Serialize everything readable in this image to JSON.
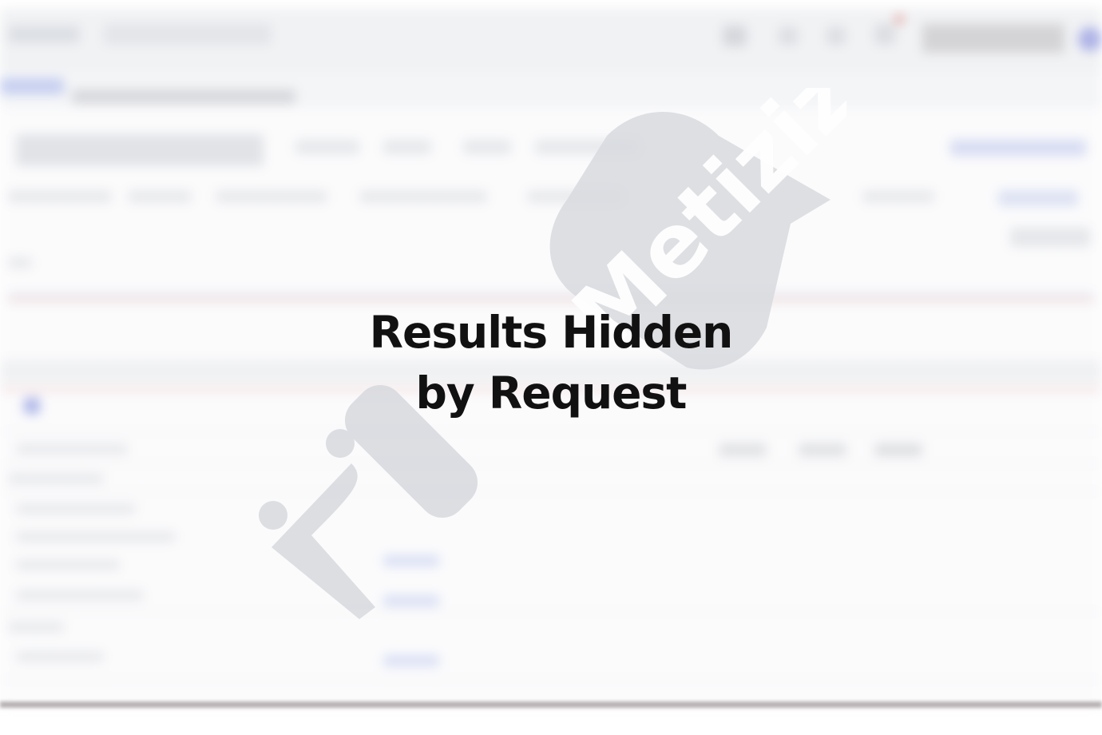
{
  "notice": {
    "line1": "Results Hidden",
    "line2": "by Request"
  },
  "watermark": {
    "logo_text": "Metizizi"
  },
  "colors": {
    "notice_text": "#111111",
    "watermark_fill": "#d6d8dd",
    "background": "#f4f5f7"
  }
}
